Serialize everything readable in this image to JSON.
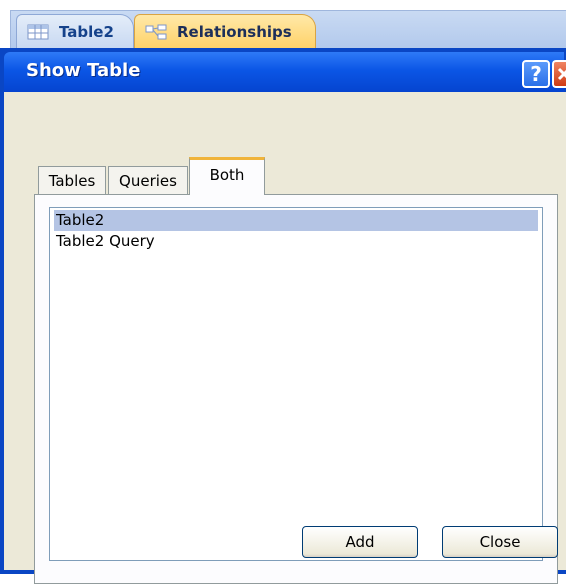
{
  "document_tabs": [
    {
      "label": "Table2",
      "icon": "table-icon"
    },
    {
      "label": "Relationships",
      "icon": "relationships-icon"
    }
  ],
  "dialog": {
    "title": "Show Table",
    "help_button": "?",
    "close_button_icon": "close-icon",
    "tabs": [
      {
        "label": "Tables",
        "selected": false
      },
      {
        "label": "Queries",
        "selected": false
      },
      {
        "label": "Both",
        "selected": true
      }
    ],
    "list_items": [
      {
        "label": "Table2",
        "selected": true
      },
      {
        "label": "Table2 Query",
        "selected": false
      }
    ],
    "buttons": {
      "add": "Add",
      "close": "Close"
    }
  },
  "colors": {
    "title_bar": "#0b56e6",
    "selected_tab_accent": "#f0b43b",
    "selection_highlight": "#b4c4e4",
    "active_document_tab": "#ffd269"
  }
}
